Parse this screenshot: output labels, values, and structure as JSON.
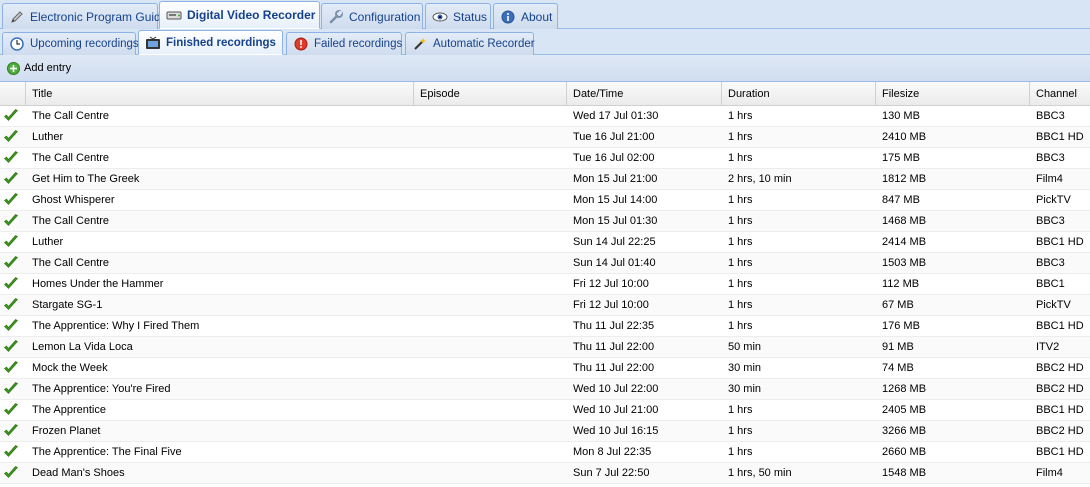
{
  "main_tabs": [
    {
      "label": "Electronic Program Guide",
      "icon": "pencil-icon"
    },
    {
      "label": "Digital Video Recorder",
      "icon": "drive-icon",
      "active": true
    },
    {
      "label": "Configuration",
      "icon": "wrench-icon"
    },
    {
      "label": "Status",
      "icon": "eye-icon"
    },
    {
      "label": "About",
      "icon": "info-icon"
    }
  ],
  "sub_tabs": [
    {
      "label": "Upcoming recordings",
      "icon": "clock-icon"
    },
    {
      "label": "Finished recordings",
      "icon": "tv-icon",
      "active": true
    },
    {
      "label": "Failed recordings",
      "icon": "error-icon"
    },
    {
      "label": "Automatic Recorder",
      "icon": "wand-icon"
    }
  ],
  "toolbar": {
    "add_label": "Add entry"
  },
  "columns": [
    "",
    "Title",
    "Episode",
    "Date/Time",
    "Duration",
    "Filesize",
    "Channel"
  ],
  "rows": [
    {
      "title": "The Call Centre",
      "episode": "",
      "datetime": "Wed 17 Jul 01:30",
      "duration": "1 hrs",
      "filesize": "130 MB",
      "channel": "BBC3"
    },
    {
      "title": "Luther",
      "episode": "",
      "datetime": "Tue 16 Jul 21:00",
      "duration": "1 hrs",
      "filesize": "2410 MB",
      "channel": "BBC1 HD"
    },
    {
      "title": "The Call Centre",
      "episode": "",
      "datetime": "Tue 16 Jul 02:00",
      "duration": "1 hrs",
      "filesize": "175 MB",
      "channel": "BBC3"
    },
    {
      "title": "Get Him to The Greek",
      "episode": "",
      "datetime": "Mon 15 Jul 21:00",
      "duration": "2 hrs, 10 min",
      "filesize": "1812 MB",
      "channel": "Film4"
    },
    {
      "title": "Ghost Whisperer",
      "episode": "",
      "datetime": "Mon 15 Jul 14:00",
      "duration": "1 hrs",
      "filesize": "847 MB",
      "channel": "PickTV"
    },
    {
      "title": "The Call Centre",
      "episode": "",
      "datetime": "Mon 15 Jul 01:30",
      "duration": "1 hrs",
      "filesize": "1468 MB",
      "channel": "BBC3"
    },
    {
      "title": "Luther",
      "episode": "",
      "datetime": "Sun 14 Jul 22:25",
      "duration": "1 hrs",
      "filesize": "2414 MB",
      "channel": "BBC1 HD"
    },
    {
      "title": "The Call Centre",
      "episode": "",
      "datetime": "Sun 14 Jul 01:40",
      "duration": "1 hrs",
      "filesize": "1503 MB",
      "channel": "BBC3"
    },
    {
      "title": "Homes Under the Hammer",
      "episode": "",
      "datetime": "Fri 12 Jul 10:00",
      "duration": "1 hrs",
      "filesize": "112 MB",
      "channel": "BBC1"
    },
    {
      "title": "Stargate SG-1",
      "episode": "",
      "datetime": "Fri 12 Jul 10:00",
      "duration": "1 hrs",
      "filesize": "67 MB",
      "channel": "PickTV"
    },
    {
      "title": "The Apprentice: Why I Fired Them",
      "episode": "",
      "datetime": "Thu 11 Jul 22:35",
      "duration": "1 hrs",
      "filesize": "176 MB",
      "channel": "BBC1 HD"
    },
    {
      "title": "Lemon La Vida Loca",
      "episode": "",
      "datetime": "Thu 11 Jul 22:00",
      "duration": "50 min",
      "filesize": "91 MB",
      "channel": "ITV2"
    },
    {
      "title": "Mock the Week",
      "episode": "",
      "datetime": "Thu 11 Jul 22:00",
      "duration": "30 min",
      "filesize": "74 MB",
      "channel": "BBC2 HD"
    },
    {
      "title": "The Apprentice: You're Fired",
      "episode": "",
      "datetime": "Wed 10 Jul 22:00",
      "duration": "30 min",
      "filesize": "1268 MB",
      "channel": "BBC2 HD"
    },
    {
      "title": "The Apprentice",
      "episode": "",
      "datetime": "Wed 10 Jul 21:00",
      "duration": "1 hrs",
      "filesize": "2405 MB",
      "channel": "BBC1 HD"
    },
    {
      "title": "Frozen Planet",
      "episode": "",
      "datetime": "Wed 10 Jul 16:15",
      "duration": "1 hrs",
      "filesize": "3266 MB",
      "channel": "BBC2 HD"
    },
    {
      "title": "The Apprentice: The Final Five",
      "episode": "",
      "datetime": "Mon 8 Jul 22:35",
      "duration": "1 hrs",
      "filesize": "2660 MB",
      "channel": "BBC1 HD"
    },
    {
      "title": "Dead Man's Shoes",
      "episode": "",
      "datetime": "Sun 7 Jul 22:50",
      "duration": "1 hrs, 50 min",
      "filesize": "1548 MB",
      "channel": "Film4"
    }
  ],
  "colors": {
    "accent": "#15428b",
    "tab_bg": "#d8e5f4",
    "check": "#3a9a1a"
  }
}
